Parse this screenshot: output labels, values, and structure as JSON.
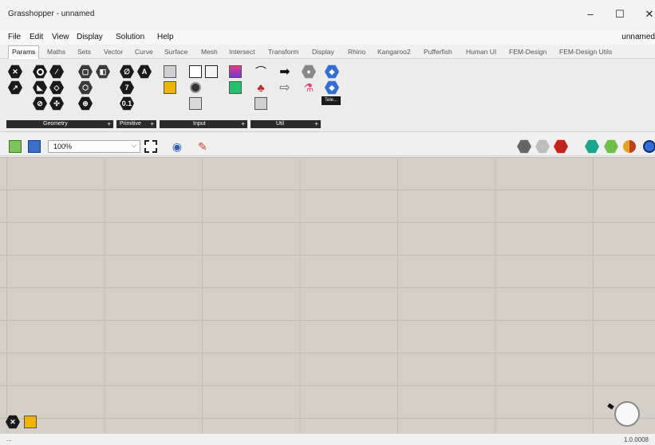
{
  "window": {
    "title": "Grasshopper - unnamed",
    "minimize": "–",
    "maximize": "☐",
    "close": "✕"
  },
  "menu": {
    "items": [
      "File",
      "Edit",
      "View",
      "Display",
      "Solution",
      "Help"
    ],
    "document_name": "unnamed"
  },
  "tabs": [
    "Params",
    "Maths",
    "Sets",
    "Vector",
    "Curve",
    "Surface",
    "Mesh",
    "Intersect",
    "Transform",
    "Display",
    "Rhino",
    "Kangaroo2",
    "Pufferfish",
    "Human UI",
    "FEM-Design",
    "FEM-Design Utils"
  ],
  "active_tab": "Params",
  "ribbon": {
    "panels": [
      {
        "label": "Geometry"
      },
      {
        "label": "Primitive"
      },
      {
        "label": "Input"
      },
      {
        "label": "Util"
      }
    ],
    "panel_expand": "+",
    "tele_label": "Tele..."
  },
  "toolbar": {
    "zoom": "100%"
  },
  "canvas": {
    "minimized_icons": [
      "close-hex-icon",
      "slider-chart-icon"
    ]
  },
  "status": {
    "left": "...",
    "version": "1.0.0008"
  },
  "colors": {
    "canvas": "#d4d0c8",
    "grid": "#c2beb5",
    "panel_label_bg": "#2b2b2b",
    "accent_blue": "#2f6fd6"
  }
}
